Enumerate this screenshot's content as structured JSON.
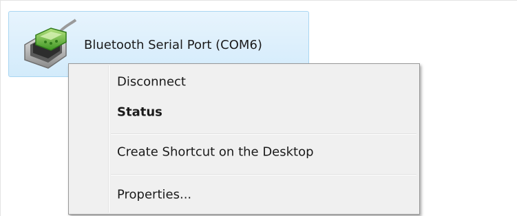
{
  "device": {
    "name": "Bluetooth Serial Port (COM6)",
    "icon": "serial-port-icon"
  },
  "context_menu": {
    "items": [
      {
        "label": "Disconnect",
        "bold": false
      },
      {
        "label": "Status",
        "bold": true
      },
      {
        "label": "Create Shortcut on the Desktop",
        "bold": false
      },
      {
        "label": "Properties...",
        "bold": false
      }
    ]
  },
  "colors": {
    "selection_border": "#a9d6f2",
    "selection_fill": "#dbeffc",
    "menu_background": "#f0f0f0",
    "icon_green": "#5fb83a"
  }
}
